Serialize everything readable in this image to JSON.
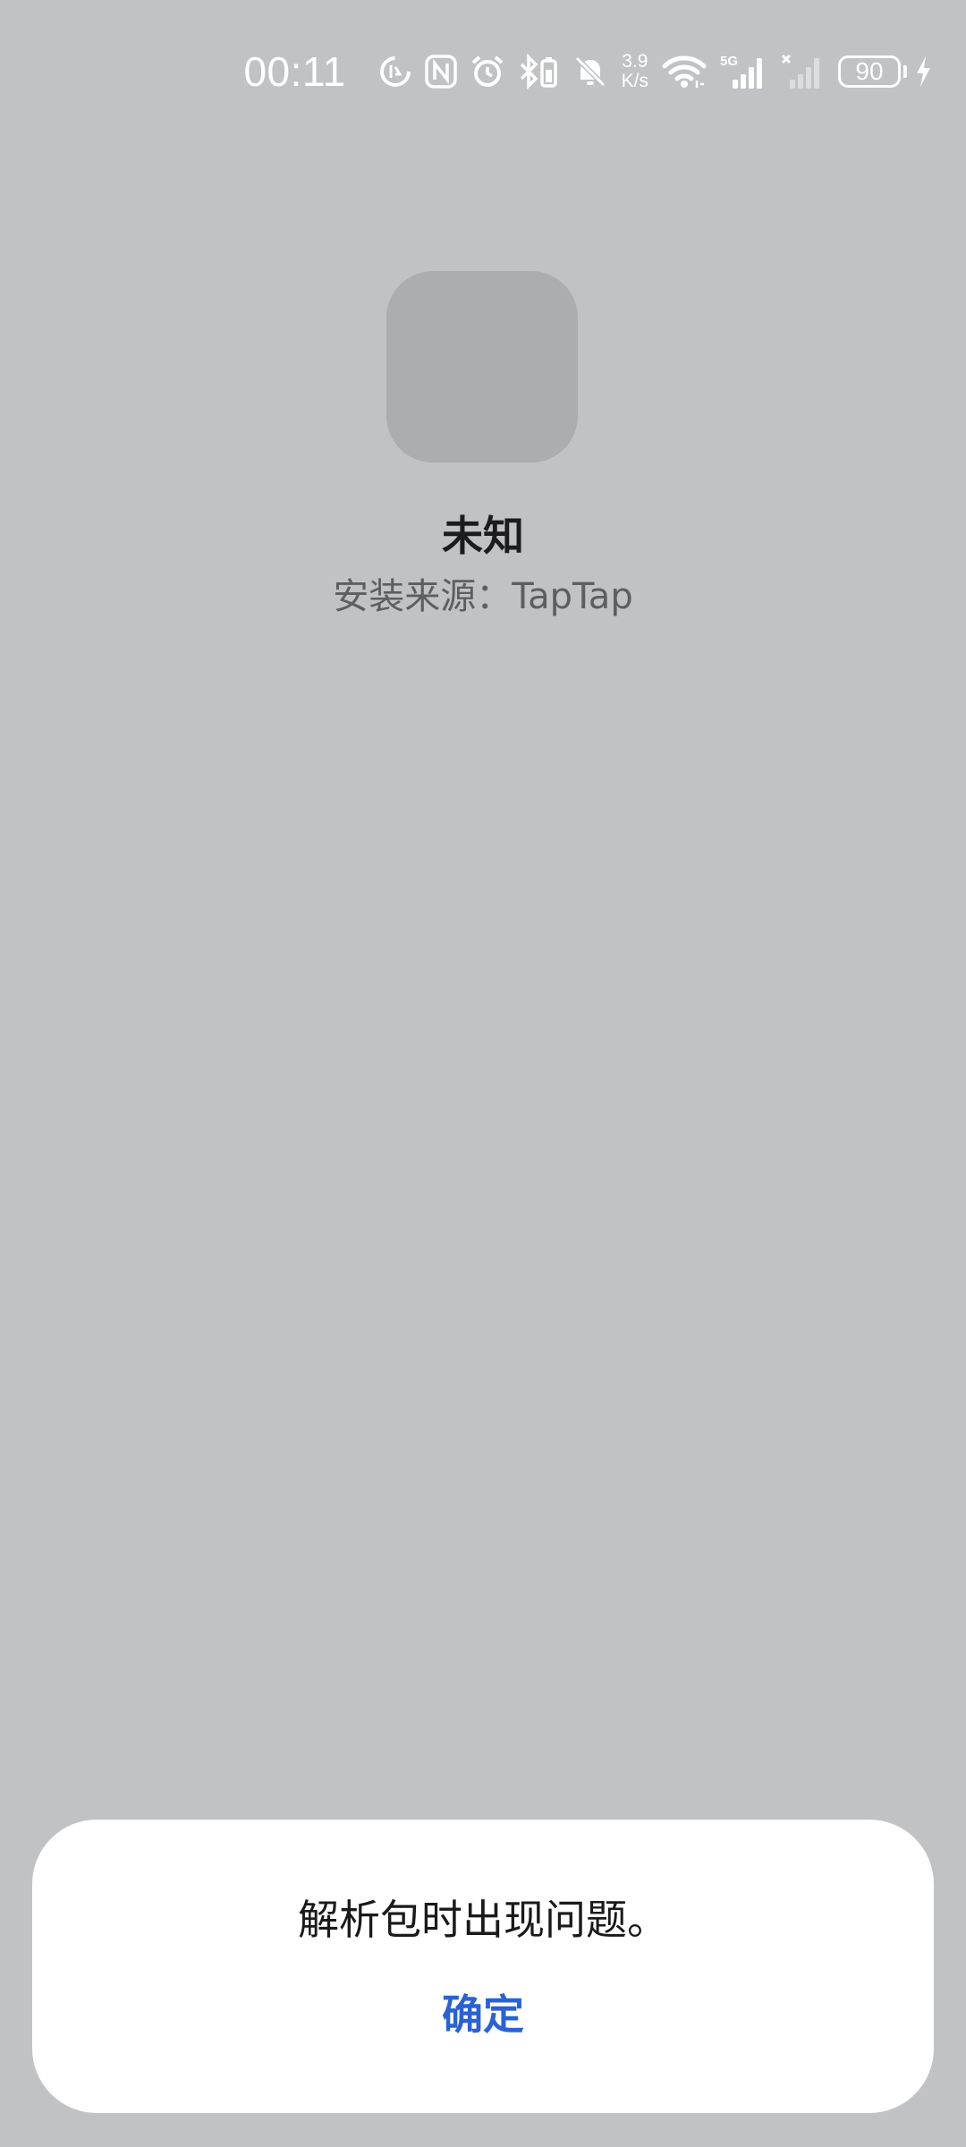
{
  "status_bar": {
    "time": "00:11",
    "net_speed_value": "3.9",
    "net_speed_unit": "K/s",
    "network_type": "5G",
    "battery_level": "90",
    "icons": [
      "data-saver-icon",
      "nfc-icon",
      "alarm-icon",
      "bluetooth-battery-icon",
      "mute-icon",
      "wifi-icon",
      "signal-5g-icon",
      "signal-no-sim-icon",
      "battery-icon",
      "charging-icon"
    ]
  },
  "app": {
    "name": "未知",
    "install_source": "安装来源：TapTap"
  },
  "dialog": {
    "message": "解析包时出现问题。",
    "confirm_label": "确定"
  },
  "colors": {
    "background": "#c1c2c4",
    "icon_placeholder": "#acadaf",
    "dialog_background": "#ffffff",
    "accent": "#2a62d4"
  }
}
